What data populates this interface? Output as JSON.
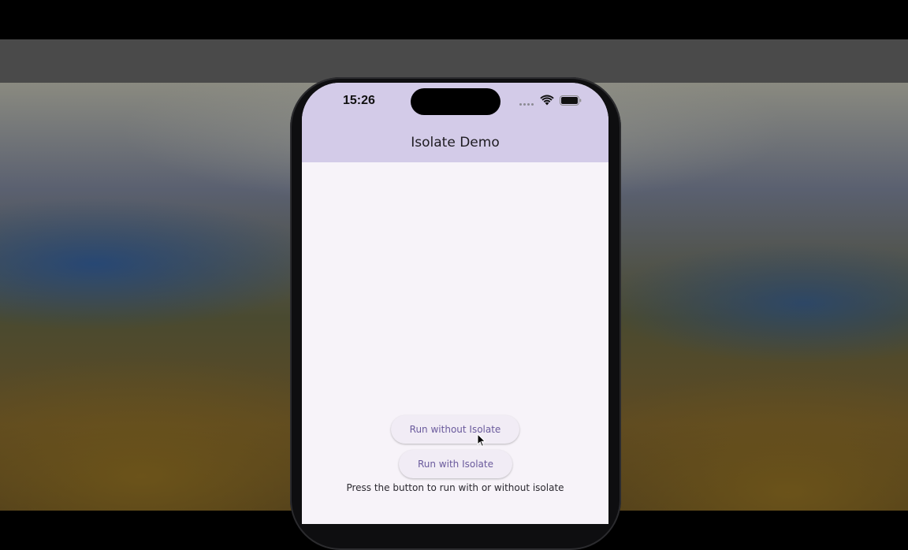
{
  "status_bar": {
    "time": "15:26",
    "icons": [
      "cellular-signal-icon",
      "wifi-icon",
      "battery-icon"
    ]
  },
  "app": {
    "title": "Isolate Demo",
    "buttons": {
      "run_without_isolate": "Run without Isolate",
      "run_with_isolate": "Run with Isolate"
    },
    "hint_text": "Press the button to run with or without isolate"
  },
  "colors": {
    "app_bar": "#d3cbe8",
    "screen_background": "#f7f3f9",
    "button_text": "#6a5a9c",
    "button_background": "#f1ecf5"
  },
  "pointer": {
    "icon": "mouse-cursor-icon"
  }
}
